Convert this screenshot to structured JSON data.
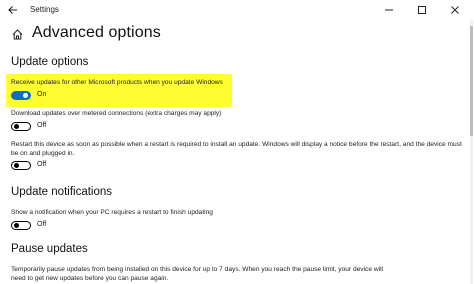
{
  "window": {
    "title": "Settings"
  },
  "page": {
    "title": "Advanced options"
  },
  "colors": {
    "accent": "#106ebe",
    "highlight": "#ffff33"
  },
  "sections": {
    "update_options": {
      "title": "Update options",
      "microsoft_products": {
        "label": "Receive updates for other Microsoft products when you update Windows",
        "state_text": "On",
        "on": true
      },
      "metered": {
        "label": "Download updates over metered connections (extra charges may apply)",
        "state_text": "Off",
        "on": false
      },
      "restart_asap": {
        "label_line1": "Restart this device as soon as possible when a restart is required to install an update. Windows will display a notice before the restart, and the device must",
        "label_line2": "be on and plugged in.",
        "state_text": "Off",
        "on": false
      }
    },
    "update_notifications": {
      "title": "Update notifications",
      "restart_notification": {
        "label": "Show a notification when your PC requires a restart to finish updating",
        "state_text": "Off",
        "on": false
      }
    },
    "pause_updates": {
      "title": "Pause updates",
      "desc_line1": "Temporarily pause updates from being installed on this device for up to 7 days. When you reach the pause limit, your device will",
      "desc_line2": "need to get new updates before you can pause again."
    }
  }
}
